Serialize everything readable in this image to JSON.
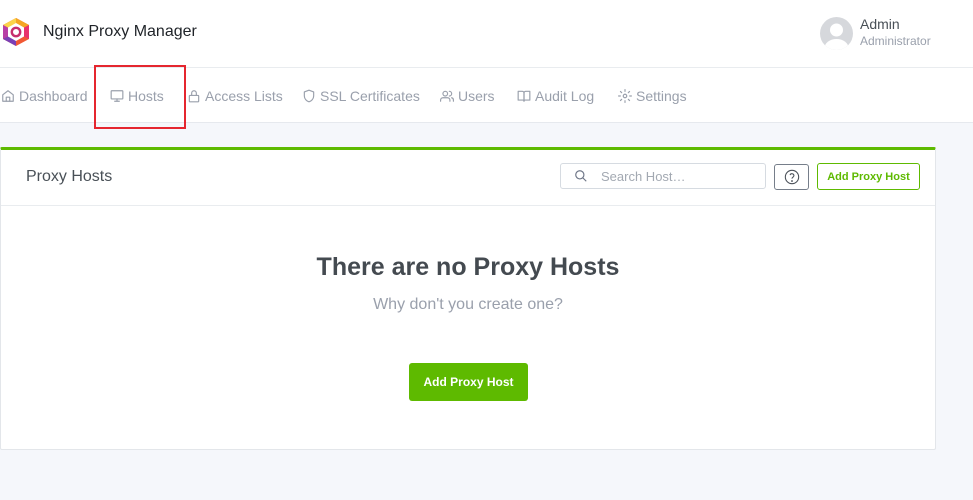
{
  "header": {
    "app_title": "Nginx Proxy Manager",
    "user": {
      "name": "Admin",
      "role": "Administrator"
    }
  },
  "nav": {
    "items": [
      {
        "label": "Dashboard",
        "icon": "home-icon"
      },
      {
        "label": "Hosts",
        "icon": "monitor-icon"
      },
      {
        "label": "Access Lists",
        "icon": "lock-icon"
      },
      {
        "label": "SSL Certificates",
        "icon": "shield-icon"
      },
      {
        "label": "Users",
        "icon": "users-icon"
      },
      {
        "label": "Audit Log",
        "icon": "book-icon"
      },
      {
        "label": "Settings",
        "icon": "gear-icon"
      }
    ]
  },
  "card": {
    "title": "Proxy Hosts",
    "search_placeholder": "Search Host…",
    "add_button_label": "Add Proxy Host",
    "empty_title": "There are no Proxy Hosts",
    "empty_subtitle": "Why don't you create one?",
    "empty_button_label": "Add Proxy Host"
  },
  "colors": {
    "accent": "#5eba00",
    "highlight": "#e5262f"
  }
}
